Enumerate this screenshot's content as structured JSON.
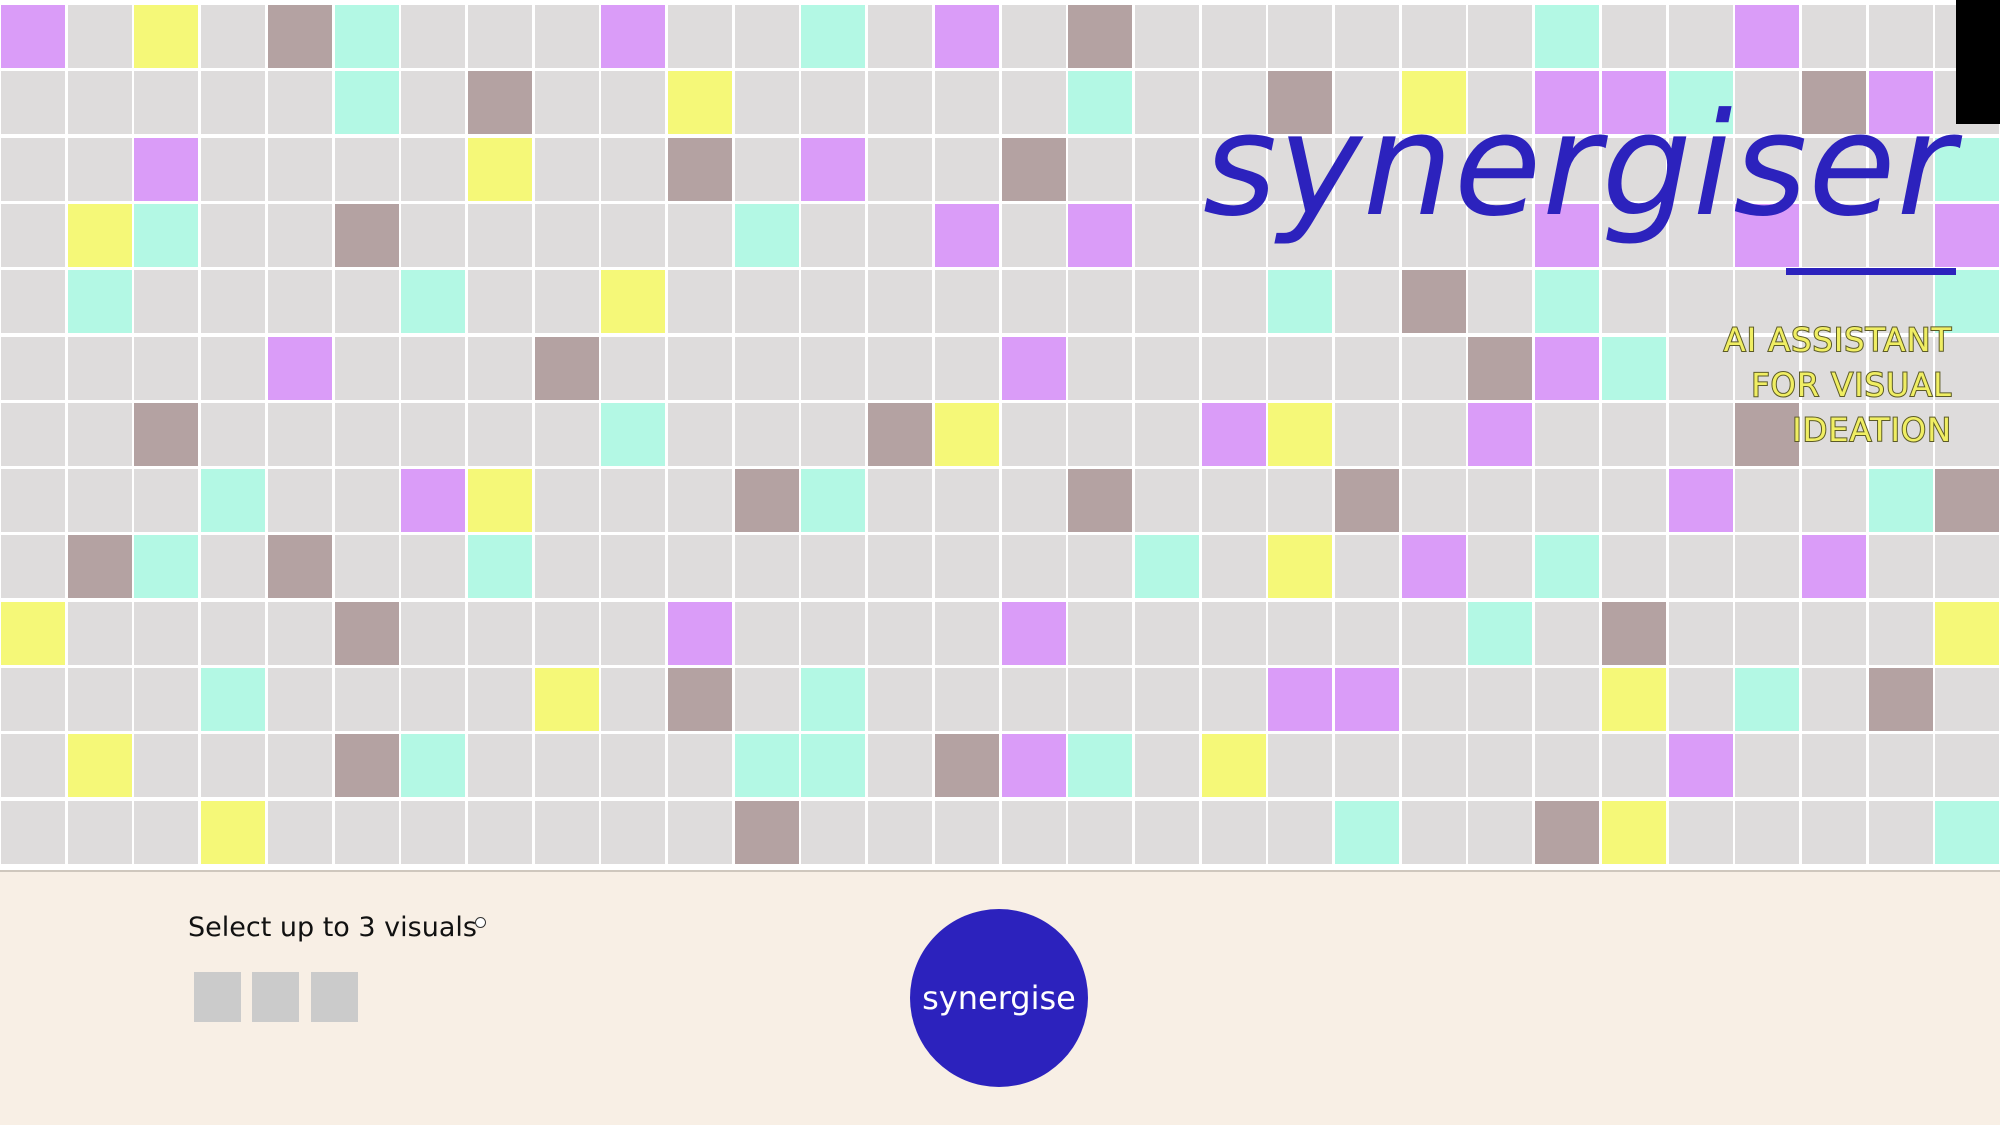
{
  "brand": {
    "title": "synergiser",
    "tagline_lines": [
      "AI ASSISTANT",
      "FOR VISUAL",
      "IDEATION"
    ],
    "title_color": "#2c22bd",
    "tagline_color": "#f0ee63"
  },
  "grid": {
    "columns": 30,
    "rows": 13,
    "palette": {
      "G": "#dedcdc",
      "C": "#b3f8e4",
      "Y": "#f5f878",
      "P": "#da9cf8",
      "B": "#b4a2a2"
    },
    "rows_pattern": [
      "PGYGBCGGGPGGCGPGBGGGGGGCGGPGGG",
      "GGGGGCGBGGYGGGGGCGGBGYGPPCGBPG",
      "GGPGGGGYGGBGPGGBGGGGGGGGGGGGGC",
      "GYCGGBGGGGGCGGPGPGGGGGGPGGPGGP",
      "GCGGGGCGGYGGGGGGGGGCGBGCGGGGGC",
      "GGGGPGGGBGGGGGGPGGGGGGBPCGGGGG",
      "GGBGGGGGGCGGGBYGGGPYGGPGGGBGGG",
      "GGGCGGPYGGGBCGGGBGGGBGGGGPGGCB",
      "GBCGBGGCGGGGGGGGGCGYGPGCGGGPGG",
      "YGGGGBGGGGPGGGGPGGGGGGCGBGGGGY",
      "GGGCGGGGYGBGCGGGGGGPPGGGYGCGBG",
      "GYGGGBCGGGGCCGBPCGYGGGGGGPGGGG",
      "GGGYGGGGGGGBGGGGGGGGCGGBYGGGGC"
    ]
  },
  "panel": {
    "select_label": "Select up to 3 visuals",
    "slot_count": 3,
    "synergise_label": "synergise",
    "button_color": "#2c22bd",
    "background": "#f8efe5"
  }
}
